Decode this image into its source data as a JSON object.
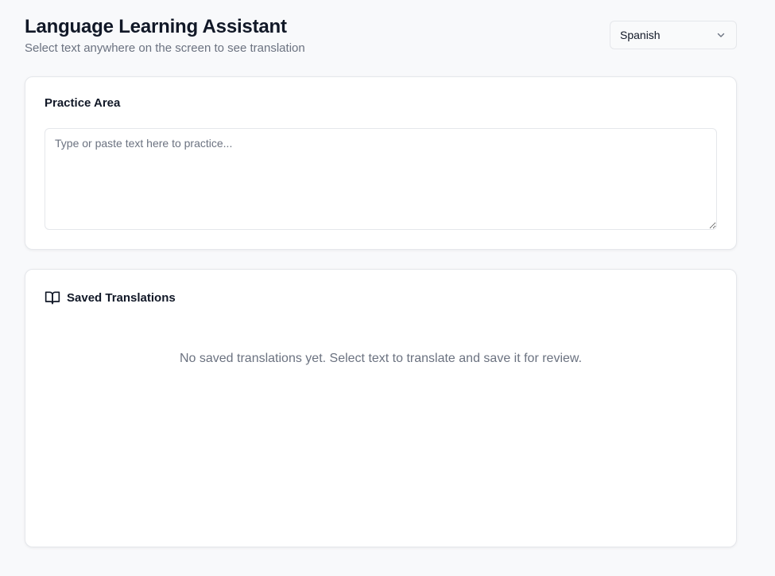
{
  "header": {
    "title": "Language Learning Assistant",
    "subtitle": "Select text anywhere on the screen to see translation"
  },
  "language_select": {
    "selected": "Spanish",
    "icon": "chevron-down-icon"
  },
  "practice": {
    "title": "Practice Area",
    "textarea_value": "",
    "textarea_placeholder": "Type or paste text here to practice..."
  },
  "saved": {
    "title": "Saved Translations",
    "icon": "book-open-icon",
    "empty_message": "No saved translations yet. Select text to translate and save it for review."
  },
  "colors": {
    "background": "#f8f9fb",
    "card": "#ffffff",
    "border": "#e5e7eb",
    "text_primary": "#111827",
    "text_muted": "#6b7280"
  }
}
